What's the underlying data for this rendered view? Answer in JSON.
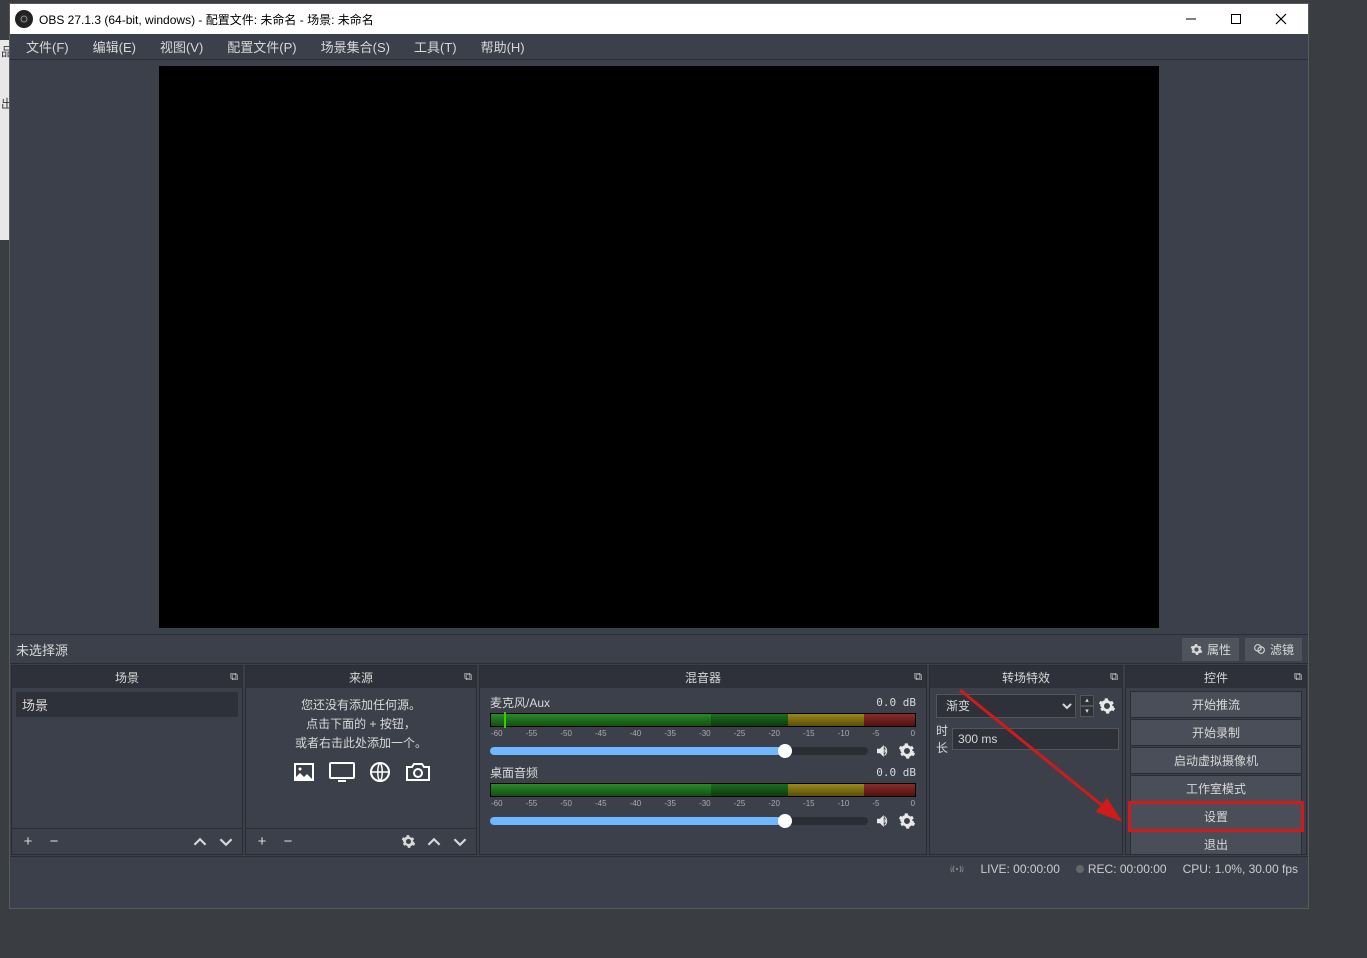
{
  "titlebar": {
    "text": "OBS 27.1.3 (64-bit, windows) - 配置文件: 未命名 - 场景: 未命名"
  },
  "menubar": [
    "文件(F)",
    "编辑(E)",
    "视图(V)",
    "配置文件(P)",
    "场景集合(S)",
    "工具(T)",
    "帮助(H)"
  ],
  "srcbar": {
    "label": "未选择源",
    "props": "属性",
    "filters": "滤镜"
  },
  "docks": {
    "scenes": {
      "title": "场景",
      "items": [
        "场景"
      ]
    },
    "sources": {
      "title": "来源",
      "empty1": "您还没有添加任何源。",
      "empty2": "点击下面的 + 按钮，",
      "empty3": "或者右击此处添加一个。"
    },
    "mixer": {
      "title": "混音器",
      "ch": [
        {
          "name": "麦克风/Aux",
          "db": "0.0 dB"
        },
        {
          "name": "桌面音频",
          "db": "0.0 dB"
        }
      ],
      "ticks": [
        "-60",
        "-55",
        "-50",
        "-45",
        "-40",
        "-35",
        "-30",
        "-25",
        "-20",
        "-15",
        "-10",
        "-5",
        "0"
      ]
    },
    "transitions": {
      "title": "转场特效",
      "selected": "渐变",
      "duration_label": "时长",
      "duration_value": "300 ms"
    },
    "controls": {
      "title": "控件",
      "buttons": [
        "开始推流",
        "开始录制",
        "启动虚拟摄像机",
        "工作室模式",
        "设置",
        "退出"
      ]
    }
  },
  "status": {
    "live": "LIVE: 00:00:00",
    "rec": "REC: 00:00:00",
    "cpu": "CPU: 1.0%, 30.00 fps"
  },
  "bgtext": "品"
}
